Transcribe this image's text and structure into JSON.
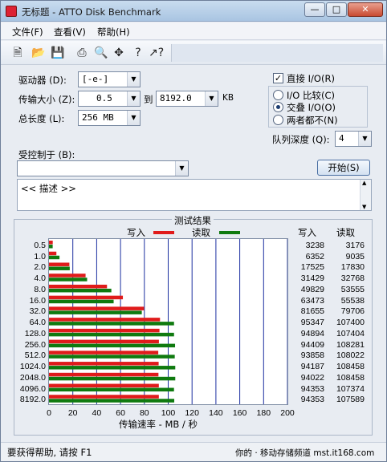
{
  "window": {
    "title": "无标题 - ATTO Disk Benchmark"
  },
  "menu": {
    "items": [
      "文件(F)",
      "查看(V)",
      "帮助(H)"
    ]
  },
  "toolbar": {
    "icons": [
      "new-file-icon",
      "open-folder-icon",
      "save-icon",
      "print-icon",
      "print-preview-icon",
      "move-icon",
      "help-icon",
      "context-help-icon"
    ]
  },
  "form": {
    "drive_label": "驱动器 (D):",
    "drive_value": "[-e-]",
    "transfer_label": "传输大小 (Z):",
    "transfer_from": "0.5",
    "to_label": "到",
    "transfer_to": "8192.0",
    "kb_label": "KB",
    "total_label": "总长度 (L):",
    "total_value": "256 MB",
    "controlled_label": "受控制于 (B):",
    "controlled_value": "",
    "direct_io_label": "直接 I/O(R)",
    "direct_io_checked": true,
    "io_compare_label": "I/O 比较(C)",
    "overlap_io_label": "交叠 I/O(O)",
    "neither_label": "两者都不(N)",
    "selected_io_mode": "overlap",
    "queue_label": "队列深度 (Q):",
    "queue_value": "4",
    "start_button": "开始(S)",
    "description": "<< 描述 >>"
  },
  "results": {
    "group_title": "测试结果",
    "legend_write": "写入",
    "legend_read": "读取",
    "col_write": "写入",
    "col_read": "读取",
    "x_label": "传输速率 - MB / 秒",
    "write_color": "#e01b1b",
    "read_color": "#0f7a0f"
  },
  "chart_data": {
    "type": "bar",
    "orientation": "horizontal",
    "categories": [
      "0.5",
      "1.0",
      "2.0",
      "4.0",
      "8.0",
      "16.0",
      "32.0",
      "64.0",
      "128.0",
      "256.0",
      "512.0",
      "1024.0",
      "2048.0",
      "4096.0",
      "8192.0"
    ],
    "series": [
      {
        "name": "写入",
        "values": [
          3238,
          6352,
          17525,
          31429,
          49829,
          63473,
          81655,
          95347,
          94894,
          94409,
          93858,
          94187,
          94022,
          94353,
          94353
        ]
      },
      {
        "name": "读取",
        "values": [
          3176,
          9035,
          17830,
          32768,
          53555,
          55538,
          79706,
          107400,
          107404,
          108281,
          108022,
          108458,
          108458,
          107374,
          107589
        ]
      }
    ],
    "xlabel": "传输速率 - MB / 秒",
    "xticks": [
      "0",
      "20",
      "40",
      "60",
      "80",
      "100",
      "120",
      "140",
      "160",
      "180",
      "200"
    ],
    "xlim": [
      0,
      200
    ],
    "value_scale": "KB/s shown in columns; bars in MB/s"
  },
  "status": {
    "left": "要获得帮助, 请按 F1",
    "right": "你的 · 移动存储频道  mst.it168.com"
  }
}
